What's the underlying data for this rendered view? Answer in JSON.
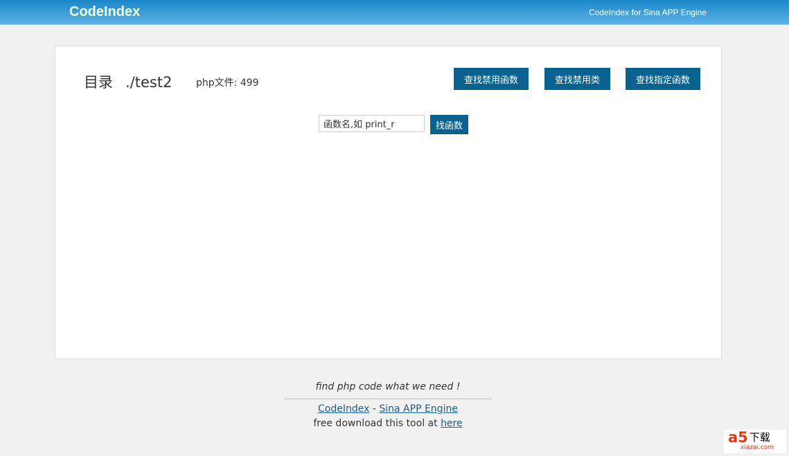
{
  "header": {
    "logo": "CodeIndex",
    "tagline": "CodeIndex for Sina APP Engine"
  },
  "main": {
    "dir_label": "目录",
    "dir_path": "./test2",
    "file_count": "php文件: 499",
    "buttons": [
      "查找禁用函数",
      "查找禁用类",
      "查找指定函数"
    ],
    "search": {
      "placeholder": "函数名,如 print_r",
      "button": "找函数"
    }
  },
  "footer": {
    "slogan": "find php code what we need !",
    "link1": "CodeIndex",
    "sep": " - ",
    "link2": "Sina APP Engine",
    "download_text": "free download this tool at ",
    "download_link": "here"
  },
  "watermark": {
    "logo": "a5",
    "text": "下载",
    "site": "xiazai.com"
  }
}
